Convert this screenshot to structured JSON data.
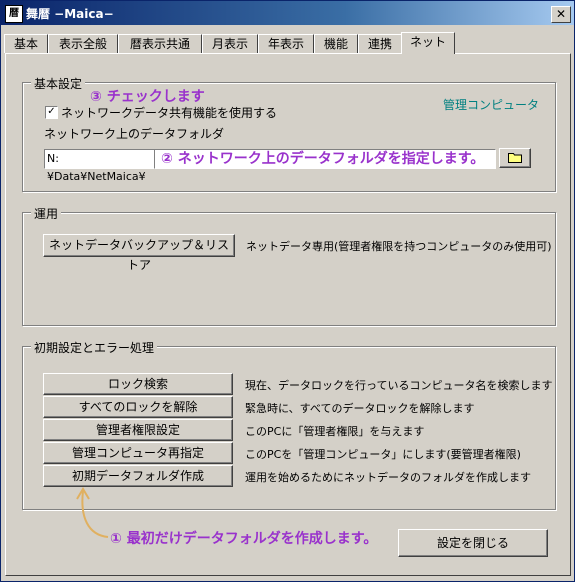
{
  "window": {
    "title": "舞暦 −Maica−",
    "app_icon": "暦",
    "close_symbol": "✕"
  },
  "tabs": [
    "基本",
    "表示全般",
    "暦表示共通",
    "月表示",
    "年表示",
    "機能",
    "連携",
    "ネット"
  ],
  "active_tab": "ネット",
  "basic": {
    "group_title": "基本設定",
    "checkbox_label": "ネットワークデータ共有機能を使用する",
    "checkbox_checked": true,
    "checkmark": "✓",
    "manager_pc_label": "管理コンピュータ",
    "folder_label": "ネットワーク上のデータフォルダ",
    "folder_value": "N:¥Data¥NetMaica¥",
    "browse_icon": "folder-icon"
  },
  "operation": {
    "group_title": "運用",
    "backup_button": "ネットデータバックアップ＆リストア",
    "backup_desc": "ネットデータ専用(管理者権限を持つコンピュータのみ使用可)"
  },
  "init": {
    "group_title": "初期設定とエラー処理",
    "rows": [
      {
        "button": "ロック検索",
        "desc": "現在、データロックを行っているコンピュータ名を検索します"
      },
      {
        "button": "すべてのロックを解除",
        "desc": "緊急時に、すべてのデータロックを解除します"
      },
      {
        "button": "管理者権限設定",
        "desc": "このPCに「管理者権限」を与えます"
      },
      {
        "button": "管理コンピュータ再指定",
        "desc": "このPCを「管理コンピュータ」にします(要管理者権限)"
      },
      {
        "button": "初期データフォルダ作成",
        "desc": "運用を始めるためにネットデータのフォルダを作成します"
      }
    ]
  },
  "close_button": "設定を閉じる",
  "annotations": {
    "a1": "① 最初だけデータフォルダを作成します。",
    "a2": "② ネットワーク上のデータフォルダを指定します。",
    "a3": "③ チェックします"
  },
  "colors": {
    "annotation": "#9932cc",
    "manager_pc": "#008080",
    "title_bar": "#0a246a"
  }
}
